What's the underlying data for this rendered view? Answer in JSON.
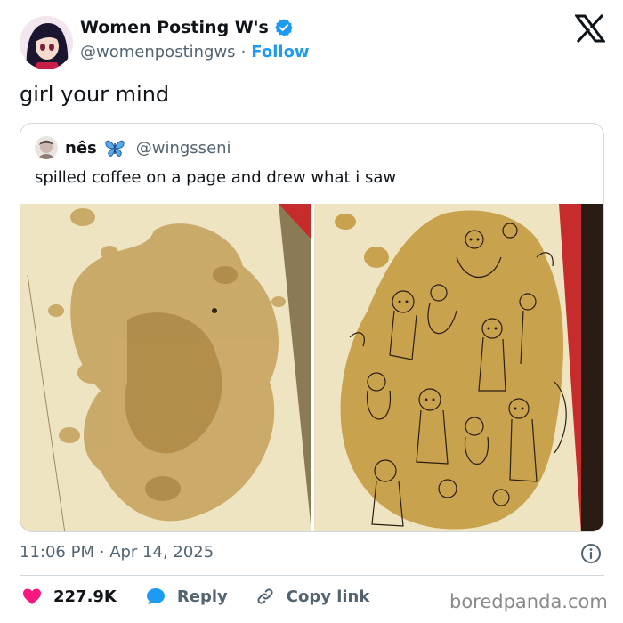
{
  "author": {
    "display_name": "Women Posting W's",
    "handle": "@womenpostingws",
    "separator": "·",
    "follow_label": "Follow",
    "verified_icon": "verified-badge-icon"
  },
  "tweet": {
    "text": "girl your mind"
  },
  "quoted": {
    "display_name": "nês",
    "emoji_icon": "butterfly-icon",
    "handle": "@wingsseni",
    "text": "spilled coffee on a page and drew what i saw",
    "images": [
      "coffee-stain-photo",
      "coffee-stain-drawing-photo"
    ]
  },
  "meta": {
    "time": "11:06 PM",
    "separator": "·",
    "date": "Apr 14, 2025"
  },
  "actions": {
    "like_count": "227.9K",
    "reply_label": "Reply",
    "copy_link_label": "Copy link"
  },
  "watermark": "boredpanda.com",
  "colors": {
    "accent": "#1d9bf0",
    "like": "#f91880",
    "text": "#0f1419",
    "secondary": "#536471",
    "border": "#cfd9de"
  }
}
